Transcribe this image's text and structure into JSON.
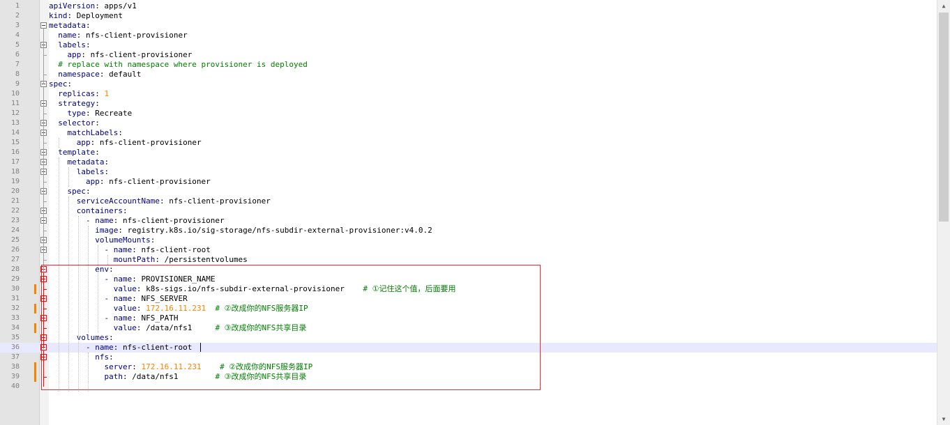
{
  "editor": {
    "language": "yaml",
    "current_line": 36,
    "lines": [
      {
        "n": "1",
        "tokens": [
          [
            "k",
            "apiVersion"
          ],
          [
            "t",
            ": apps/v1"
          ]
        ]
      },
      {
        "n": "2",
        "tokens": [
          [
            "k",
            "kind"
          ],
          [
            "t",
            ": Deployment"
          ]
        ]
      },
      {
        "n": "3",
        "tokens": [
          [
            "k",
            "metadata"
          ],
          [
            "t",
            ":"
          ]
        ]
      },
      {
        "n": "4",
        "tokens": [
          [
            "t",
            "  "
          ],
          [
            "k",
            "name"
          ],
          [
            "t",
            ": nfs-client-provisioner"
          ]
        ]
      },
      {
        "n": "5",
        "tokens": [
          [
            "t",
            "  "
          ],
          [
            "k",
            "labels"
          ],
          [
            "t",
            ":"
          ]
        ]
      },
      {
        "n": "6",
        "tokens": [
          [
            "t",
            "    "
          ],
          [
            "k",
            "app"
          ],
          [
            "t",
            ": nfs-client-provisioner"
          ]
        ]
      },
      {
        "n": "7",
        "tokens": [
          [
            "t",
            "  "
          ],
          [
            "c",
            "# replace with namespace where provisioner is deployed"
          ]
        ]
      },
      {
        "n": "8",
        "tokens": [
          [
            "t",
            "  "
          ],
          [
            "k",
            "namespace"
          ],
          [
            "t",
            ": default"
          ]
        ]
      },
      {
        "n": "9",
        "tokens": [
          [
            "k",
            "spec"
          ],
          [
            "t",
            ":"
          ]
        ]
      },
      {
        "n": "10",
        "tokens": [
          [
            "t",
            "  "
          ],
          [
            "k",
            "replicas"
          ],
          [
            "t",
            ": "
          ],
          [
            "n",
            "1"
          ]
        ]
      },
      {
        "n": "11",
        "tokens": [
          [
            "t",
            "  "
          ],
          [
            "k",
            "strategy"
          ],
          [
            "t",
            ":"
          ]
        ]
      },
      {
        "n": "12",
        "tokens": [
          [
            "t",
            "    "
          ],
          [
            "k",
            "type"
          ],
          [
            "t",
            ": Recreate"
          ]
        ]
      },
      {
        "n": "13",
        "tokens": [
          [
            "t",
            "  "
          ],
          [
            "k",
            "selector"
          ],
          [
            "t",
            ":"
          ]
        ]
      },
      {
        "n": "14",
        "tokens": [
          [
            "t",
            "    "
          ],
          [
            "k",
            "matchLabels"
          ],
          [
            "t",
            ":"
          ]
        ]
      },
      {
        "n": "15",
        "tokens": [
          [
            "t",
            "      "
          ],
          [
            "k",
            "app"
          ],
          [
            "t",
            ": nfs-client-provisioner"
          ]
        ]
      },
      {
        "n": "16",
        "tokens": [
          [
            "t",
            "  "
          ],
          [
            "k",
            "template"
          ],
          [
            "t",
            ":"
          ]
        ]
      },
      {
        "n": "17",
        "tokens": [
          [
            "t",
            "    "
          ],
          [
            "k",
            "metadata"
          ],
          [
            "t",
            ":"
          ]
        ]
      },
      {
        "n": "18",
        "tokens": [
          [
            "t",
            "      "
          ],
          [
            "k",
            "labels"
          ],
          [
            "t",
            ":"
          ]
        ]
      },
      {
        "n": "19",
        "tokens": [
          [
            "t",
            "        "
          ],
          [
            "k",
            "app"
          ],
          [
            "t",
            ": nfs-client-provisioner"
          ]
        ]
      },
      {
        "n": "20",
        "tokens": [
          [
            "t",
            "    "
          ],
          [
            "k",
            "spec"
          ],
          [
            "t",
            ":"
          ]
        ]
      },
      {
        "n": "21",
        "tokens": [
          [
            "t",
            "      "
          ],
          [
            "k",
            "serviceAccountName"
          ],
          [
            "t",
            ": nfs-client-provisioner"
          ]
        ]
      },
      {
        "n": "22",
        "tokens": [
          [
            "t",
            "      "
          ],
          [
            "k",
            "containers"
          ],
          [
            "t",
            ":"
          ]
        ]
      },
      {
        "n": "23",
        "tokens": [
          [
            "t",
            "        "
          ],
          [
            "k",
            "- name"
          ],
          [
            "t",
            ": nfs-client-provisioner"
          ]
        ]
      },
      {
        "n": "24",
        "tokens": [
          [
            "t",
            "          "
          ],
          [
            "k",
            "image"
          ],
          [
            "t",
            ": registry.k8s.io/sig-storage/nfs-subdir-external-provisioner:v4.0.2"
          ]
        ]
      },
      {
        "n": "25",
        "tokens": [
          [
            "t",
            "          "
          ],
          [
            "k",
            "volumeMounts"
          ],
          [
            "t",
            ":"
          ]
        ]
      },
      {
        "n": "26",
        "tokens": [
          [
            "t",
            "            "
          ],
          [
            "k",
            "- name"
          ],
          [
            "t",
            ": nfs-client-root"
          ]
        ]
      },
      {
        "n": "27",
        "tokens": [
          [
            "t",
            "              "
          ],
          [
            "k",
            "mountPath"
          ],
          [
            "t",
            ": /persistentvolumes"
          ]
        ]
      },
      {
        "n": "28",
        "tokens": [
          [
            "t",
            "          "
          ],
          [
            "k",
            "env"
          ],
          [
            "t",
            ":"
          ]
        ]
      },
      {
        "n": "29",
        "tokens": [
          [
            "t",
            "            "
          ],
          [
            "k",
            "- name"
          ],
          [
            "t",
            ": PROVISIONER_NAME"
          ]
        ]
      },
      {
        "n": "30",
        "tokens": [
          [
            "t",
            "              "
          ],
          [
            "k",
            "value"
          ],
          [
            "t",
            ": k8s-sigs.io/nfs-subdir-external-provisioner    "
          ],
          [
            "c",
            "# ①记住这个值，后面要用"
          ]
        ]
      },
      {
        "n": "31",
        "tokens": [
          [
            "t",
            "            "
          ],
          [
            "k",
            "- name"
          ],
          [
            "t",
            ": NFS_SERVER"
          ]
        ]
      },
      {
        "n": "32",
        "tokens": [
          [
            "t",
            "              "
          ],
          [
            "k",
            "value"
          ],
          [
            "t",
            ": "
          ],
          [
            "n",
            "172.16.11.231"
          ],
          [
            "t",
            "  "
          ],
          [
            "c",
            "# ②改成你的NFS服务器IP"
          ]
        ]
      },
      {
        "n": "33",
        "tokens": [
          [
            "t",
            "            "
          ],
          [
            "k",
            "- name"
          ],
          [
            "t",
            ": NFS_PATH"
          ]
        ]
      },
      {
        "n": "34",
        "tokens": [
          [
            "t",
            "              "
          ],
          [
            "k",
            "value"
          ],
          [
            "t",
            ": /data/nfs1     "
          ],
          [
            "c",
            "# ③改成你的NFS共享目录"
          ]
        ]
      },
      {
        "n": "35",
        "tokens": [
          [
            "t",
            "      "
          ],
          [
            "k",
            "volumes"
          ],
          [
            "t",
            ":"
          ]
        ]
      },
      {
        "n": "36",
        "tokens": [
          [
            "t",
            "        "
          ],
          [
            "k",
            "- name"
          ],
          [
            "t",
            ": nfs-client-root"
          ]
        ]
      },
      {
        "n": "37",
        "tokens": [
          [
            "t",
            "          "
          ],
          [
            "k",
            "nfs"
          ],
          [
            "t",
            ":"
          ]
        ]
      },
      {
        "n": "38",
        "tokens": [
          [
            "t",
            "            "
          ],
          [
            "k",
            "server"
          ],
          [
            "t",
            ": "
          ],
          [
            "n",
            "172.16.11.231"
          ],
          [
            "t",
            "    "
          ],
          [
            "c",
            "# ②改成你的NFS服务器IP"
          ]
        ]
      },
      {
        "n": "39",
        "tokens": [
          [
            "t",
            "            "
          ],
          [
            "k",
            "path"
          ],
          [
            "t",
            ": /data/nfs1        "
          ],
          [
            "c",
            "# ③改成你的NFS共享目录"
          ]
        ]
      },
      {
        "n": "40",
        "tokens": []
      }
    ],
    "modified_lines": [
      30,
      32,
      34,
      38,
      39
    ],
    "colors": {
      "key": "#000080",
      "number": "#ff8000",
      "comment": "#008000",
      "change_marker": "#ff8000",
      "highlight_box": "#e03030",
      "current_line": "#e8e8ff"
    },
    "scrollbar": {
      "up_icon": "triangle-up",
      "down_icon": "triangle-down"
    }
  }
}
